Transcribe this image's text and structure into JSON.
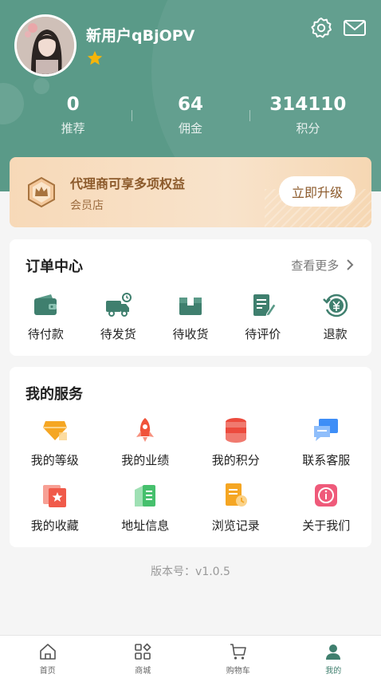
{
  "profile": {
    "username": "新用户qBjOPV",
    "stats": [
      {
        "value": "0",
        "label": "推荐"
      },
      {
        "value": "64",
        "label": "佣金"
      },
      {
        "value": "314110",
        "label": "积分"
      }
    ]
  },
  "promo": {
    "title": "代理商可享多项权益",
    "subtitle": "会员店",
    "button_label": "立即升级"
  },
  "orders": {
    "title": "订单中心",
    "more_label": "查看更多",
    "items": [
      {
        "label": "待付款",
        "icon": "wallet-icon"
      },
      {
        "label": "待发货",
        "icon": "delivery-truck-icon"
      },
      {
        "label": "待收货",
        "icon": "package-box-icon"
      },
      {
        "label": "待评价",
        "icon": "review-edit-icon"
      },
      {
        "label": "退款",
        "icon": "refund-yen-icon"
      }
    ]
  },
  "services": {
    "title": "我的服务",
    "items": [
      {
        "label": "我的等级",
        "icon": "level-diamond-icon",
        "color": "#f5a623"
      },
      {
        "label": "我的业绩",
        "icon": "rocket-icon",
        "color": "#f0533a"
      },
      {
        "label": "我的积分",
        "icon": "coin-stack-icon",
        "color": "#ec4b3d"
      },
      {
        "label": "联系客服",
        "icon": "chat-bubble-icon",
        "color": "#3e8ef7"
      },
      {
        "label": "我的收藏",
        "icon": "favorite-star-card-icon",
        "color": "#f05a4a"
      },
      {
        "label": "地址信息",
        "icon": "address-building-icon",
        "color": "#46c06d"
      },
      {
        "label": "浏览记录",
        "icon": "history-doc-icon",
        "color": "#f5a623"
      },
      {
        "label": "关于我们",
        "icon": "info-icon",
        "color": "#ef5a7a"
      }
    ]
  },
  "version_text": "版本号：v1.0.5",
  "tabbar": {
    "items": [
      {
        "label": "首页",
        "icon": "home-icon"
      },
      {
        "label": "商城",
        "icon": "grid-apps-icon"
      },
      {
        "label": "购物车",
        "icon": "cart-icon"
      },
      {
        "label": "我的",
        "icon": "user-icon"
      }
    ],
    "active_index": 3,
    "active_color": "#3f7f6e"
  },
  "theme": {
    "primary": "#5a9a88",
    "promo_text": "#8c5a2b",
    "order_icon": "#3f7f6e"
  }
}
